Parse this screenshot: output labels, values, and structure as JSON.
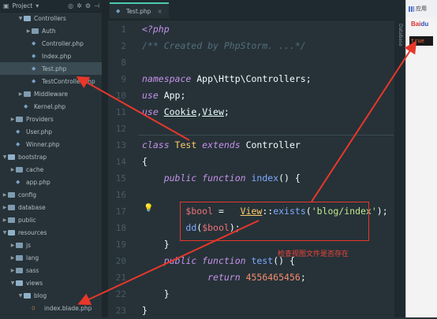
{
  "project_panel": {
    "header": {
      "title": "Project"
    },
    "tree": [
      {
        "label": "Controllers",
        "kind": "folder",
        "open": true,
        "indent": 3
      },
      {
        "label": "Auth",
        "kind": "folder",
        "open": false,
        "indent": 4
      },
      {
        "label": "Controller.php",
        "kind": "php",
        "indent": 4
      },
      {
        "label": "Index.php",
        "kind": "php",
        "indent": 4
      },
      {
        "label": "Test.php",
        "kind": "php",
        "indent": 4,
        "selected": true
      },
      {
        "label": "TestController.php",
        "kind": "php",
        "indent": 4
      },
      {
        "label": "Middleware",
        "kind": "folder",
        "open": false,
        "indent": 3
      },
      {
        "label": "Kernel.php",
        "kind": "php",
        "indent": 3
      },
      {
        "label": "Providers",
        "kind": "folder",
        "open": false,
        "indent": 2
      },
      {
        "label": "User.php",
        "kind": "php",
        "indent": 2
      },
      {
        "label": "Winner.php",
        "kind": "php",
        "indent": 2
      },
      {
        "label": "bootstrap",
        "kind": "folder",
        "open": true,
        "indent": 1
      },
      {
        "label": "cache",
        "kind": "folder",
        "open": false,
        "indent": 2
      },
      {
        "label": "app.php",
        "kind": "php",
        "indent": 2
      },
      {
        "label": "config",
        "kind": "folder",
        "open": false,
        "indent": 1
      },
      {
        "label": "database",
        "kind": "folder",
        "open": false,
        "indent": 1
      },
      {
        "label": "public",
        "kind": "folder",
        "open": false,
        "indent": 1
      },
      {
        "label": "resources",
        "kind": "folder",
        "open": true,
        "indent": 1
      },
      {
        "label": "js",
        "kind": "folder",
        "open": false,
        "indent": 2
      },
      {
        "label": "lang",
        "kind": "folder",
        "open": false,
        "indent": 2
      },
      {
        "label": "sass",
        "kind": "folder",
        "open": false,
        "indent": 2
      },
      {
        "label": "views",
        "kind": "folder",
        "open": true,
        "indent": 2
      },
      {
        "label": "blog",
        "kind": "folder",
        "open": true,
        "indent": 3
      },
      {
        "label": "index.blade.php",
        "kind": "blade",
        "indent": 4
      }
    ]
  },
  "editor": {
    "tab": {
      "label": "Test.php"
    },
    "line_numbers": [
      "1",
      "2",
      "8",
      "9",
      "10",
      "11",
      "12",
      "13",
      "14",
      "15",
      "16",
      "17",
      "18",
      "19",
      "20",
      "21",
      "22",
      "23"
    ],
    "lines": [
      [
        [
          "kw",
          "<?php"
        ]
      ],
      [
        [
          "cm",
          "/** Created by PhpStorm. ...*/"
        ]
      ],
      [],
      [
        [
          "kw",
          "namespace "
        ],
        [
          "plain",
          "App\\Http\\Controllers;"
        ]
      ],
      [
        [
          "kw",
          "use "
        ],
        [
          "plain",
          "App;"
        ]
      ],
      [
        [
          "kw",
          "use "
        ],
        [
          "plainul",
          "Cookie"
        ],
        [
          "plain",
          ","
        ],
        [
          "plainul",
          "View"
        ],
        [
          "plain",
          ";"
        ]
      ],
      [],
      [
        [
          "kw",
          "class "
        ],
        [
          "cls",
          "Test "
        ],
        [
          "kw",
          "extends "
        ],
        [
          "plain",
          "Controller"
        ]
      ],
      [
        [
          "plain",
          "{"
        ]
      ],
      [
        [
          "plain",
          "    "
        ],
        [
          "kw",
          "public function "
        ],
        [
          "fn",
          "index"
        ],
        [
          "plain",
          "() {"
        ]
      ],
      [],
      [
        [
          "plain",
          "        "
        ],
        [
          "var",
          "$bool"
        ],
        [
          "plain",
          " =   "
        ],
        [
          "clsul",
          "View"
        ],
        [
          "plain",
          "::"
        ],
        [
          "fn",
          "exists"
        ],
        [
          "plain",
          "("
        ],
        [
          "str",
          "'blog/index'"
        ],
        [
          "plain",
          ");"
        ]
      ],
      [
        [
          "plain",
          "        "
        ],
        [
          "fn",
          "dd"
        ],
        [
          "plain",
          "("
        ],
        [
          "var",
          "$bool"
        ],
        [
          "plain",
          ");"
        ]
      ],
      [
        [
          "plain",
          "    }"
        ]
      ],
      [
        [
          "plain",
          "    "
        ],
        [
          "kw",
          "public function "
        ],
        [
          "fn",
          "test"
        ],
        [
          "plain",
          "() {"
        ]
      ],
      [
        [
          "plain",
          "            "
        ],
        [
          "kw",
          "return "
        ],
        [
          "num",
          "4556465456"
        ],
        [
          "plain",
          ";"
        ]
      ],
      [
        [
          "plain",
          "    }"
        ]
      ],
      [
        [
          "plain",
          "}"
        ]
      ]
    ],
    "annotation": "检查视图文件是否存在"
  },
  "scrollbar": {
    "label": "Database"
  },
  "browser": {
    "apps_label": "应用",
    "logo_text": "Bai",
    "logo_paw": "du",
    "result": "true"
  },
  "colors": {
    "annotation_red": "#e8372a",
    "background": "#263238"
  }
}
